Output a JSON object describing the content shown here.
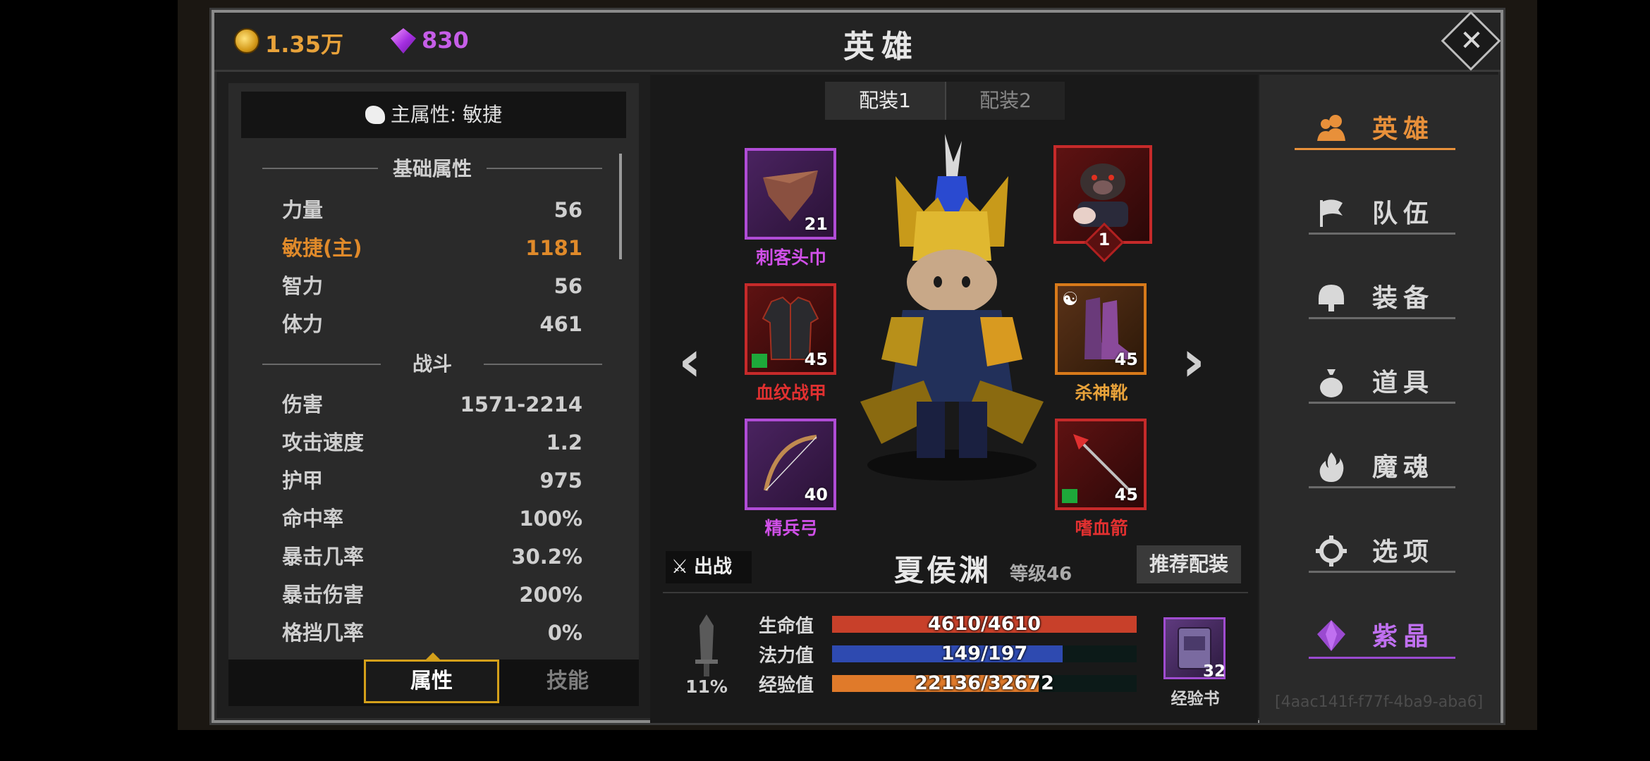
{
  "header": {
    "title": "英雄",
    "gold": "1.35万",
    "gems": "830"
  },
  "stats_panel": {
    "main_attr": "主属性: 敏捷",
    "section_basic": "基础属性",
    "basic": [
      {
        "label": "力量",
        "value": "56"
      },
      {
        "label": "敏捷(主)",
        "value": "1181"
      },
      {
        "label": "智力",
        "value": "56"
      },
      {
        "label": "体力",
        "value": "461"
      }
    ],
    "section_combat": "战斗",
    "combat": [
      {
        "label": "伤害",
        "value": "1571-2214"
      },
      {
        "label": "攻击速度",
        "value": "1.2"
      },
      {
        "label": "护甲",
        "value": "975"
      },
      {
        "label": "命中率",
        "value": "100%"
      },
      {
        "label": "暴击几率",
        "value": "30.2%"
      },
      {
        "label": "暴击伤害",
        "value": "200%"
      },
      {
        "label": "格挡几率",
        "value": "0%"
      }
    ],
    "tabs": {
      "attributes": "属性",
      "skills": "技能"
    }
  },
  "loadout": {
    "tab1": "配装1",
    "tab2": "配装2",
    "slots": [
      {
        "name": "刺客头巾",
        "level": "21"
      },
      {
        "name": "",
        "level": "1"
      },
      {
        "name": "血纹战甲",
        "level": "45"
      },
      {
        "name": "杀神靴",
        "level": "45"
      },
      {
        "name": "精兵弓",
        "level": "40"
      },
      {
        "name": "嗜血箭",
        "level": "45"
      }
    ],
    "prev_arrow": "‹",
    "next_arrow": "›"
  },
  "hero": {
    "sortie_label": "出战",
    "name": "夏侯渊",
    "level": "等级46",
    "recommend_label": "推荐配装",
    "sword_pct": "11%",
    "bars": [
      {
        "label": "生命值",
        "text": "4610/4610",
        "fill": 1.0,
        "color": "#c8402a"
      },
      {
        "label": "法力值",
        "text": "149/197",
        "fill": 0.756,
        "color": "#2e4ab0"
      },
      {
        "label": "经验值",
        "text": "22136/32672",
        "fill": 0.678,
        "color": "#e07a2a"
      }
    ],
    "exp_book": {
      "label": "经验书",
      "count": "32"
    }
  },
  "menu": {
    "items": [
      {
        "label": "英雄",
        "icon": "users-icon"
      },
      {
        "label": "队伍",
        "icon": "flag-icon"
      },
      {
        "label": "装备",
        "icon": "helmet-icon"
      },
      {
        "label": "道具",
        "icon": "bag-icon"
      },
      {
        "label": "魔魂",
        "icon": "flame-icon"
      },
      {
        "label": "选项",
        "icon": "gear-icon"
      },
      {
        "label": "紫晶",
        "icon": "crystal-icon"
      }
    ],
    "id_text": "[4aac141f-f77f-4ba9-aba6]"
  }
}
